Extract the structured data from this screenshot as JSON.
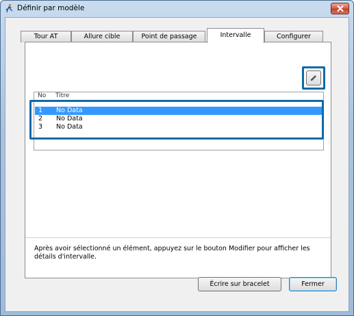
{
  "window": {
    "title": "Définir par modèle",
    "icons": {
      "app": "runner-icon",
      "close": "close-icon"
    }
  },
  "tabs": [
    {
      "label": "Tour AT",
      "active": false
    },
    {
      "label": "Allure cible",
      "active": false
    },
    {
      "label": "Point de passage",
      "active": false
    },
    {
      "label": "Intervalle",
      "active": true
    },
    {
      "label": "Configurer",
      "active": false
    }
  ],
  "toolbar": {
    "edit_icon": "pencil-icon"
  },
  "list": {
    "columns": [
      "No",
      "Titre"
    ],
    "rows": [
      {
        "no": "1",
        "title": "No Data",
        "selected": true
      },
      {
        "no": "2",
        "title": "No Data",
        "selected": false
      },
      {
        "no": "3",
        "title": "No Data",
        "selected": false
      }
    ]
  },
  "help_text": "Après avoir sélectionné un élément, appuyez sur le bouton Modifier pour afficher les détails d'intervalle.",
  "buttons": {
    "write": "Écrire sur bracelet",
    "close": "Fermer"
  },
  "colors": {
    "selection": "#3399ff",
    "highlight": "#0a6aa8"
  }
}
